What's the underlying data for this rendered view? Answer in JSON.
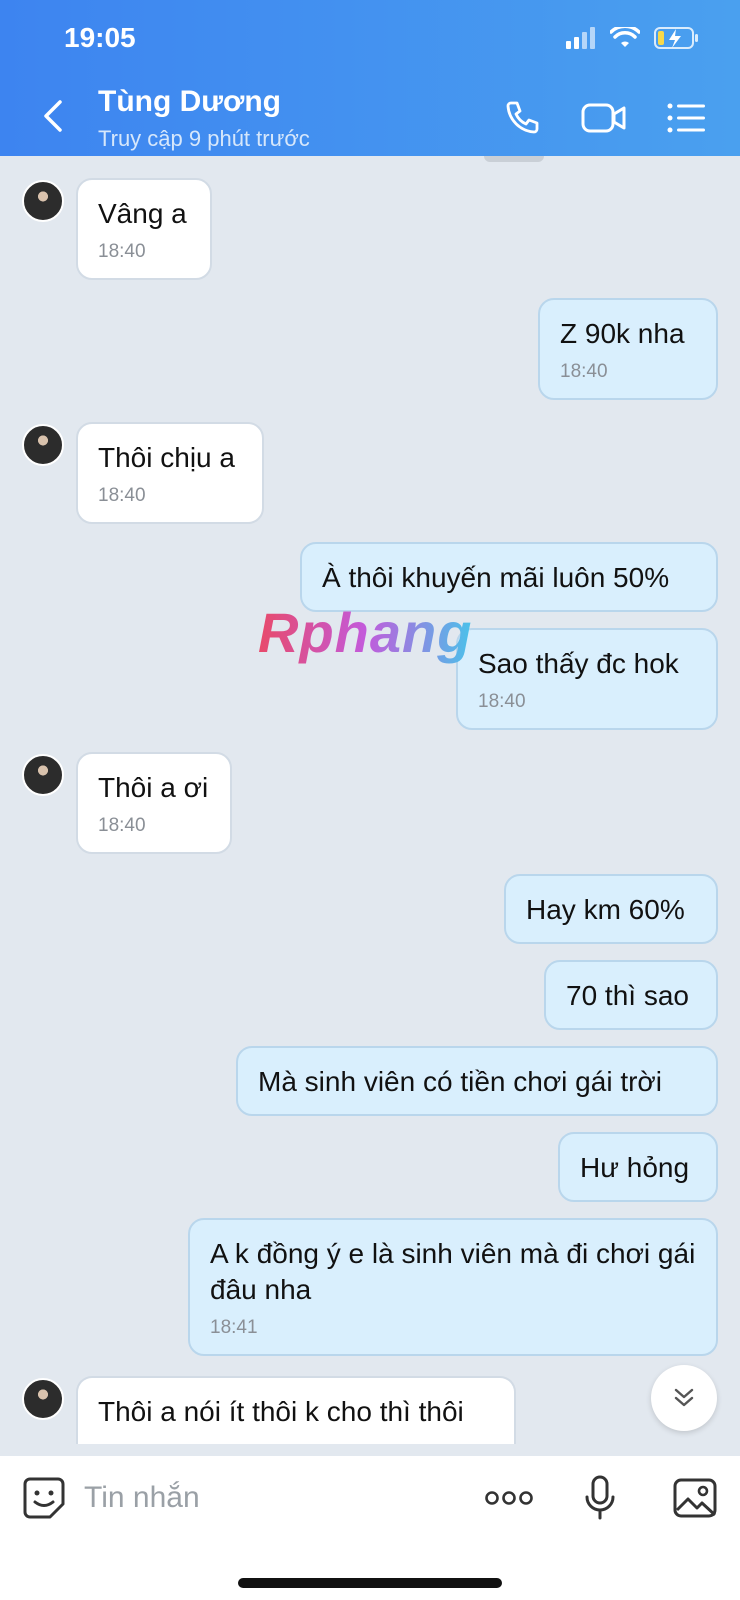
{
  "status_bar": {
    "time": "19:05"
  },
  "header": {
    "name": "Tùng Dương",
    "subtitle": "Truy cập 9 phút trước"
  },
  "messages": [
    {
      "side": "in",
      "text": "Vâng a",
      "time": "18:40"
    },
    {
      "side": "out",
      "text": "Z 90k nha",
      "time": "18:40"
    },
    {
      "side": "in",
      "text": "Thôi chịu a",
      "time": "18:40"
    },
    {
      "side": "out",
      "text": "À thôi khuyến mãi luôn 50%",
      "time": ""
    },
    {
      "side": "out",
      "text": "Sao thấy đc hok",
      "time": "18:40"
    },
    {
      "side": "in",
      "text": "Thôi a ơi",
      "time": "18:40"
    },
    {
      "side": "out",
      "text": "Hay km 60%",
      "time": ""
    },
    {
      "side": "out",
      "text": "70 thì sao",
      "time": ""
    },
    {
      "side": "out",
      "text": "Mà sinh viên có tiền chơi gái trời",
      "time": ""
    },
    {
      "side": "out",
      "text": "Hư hỏng",
      "time": ""
    },
    {
      "side": "out",
      "text": "A k đồng ý e là sinh viên mà đi chơi gái đâu nha",
      "time": "18:41"
    },
    {
      "side": "in",
      "text": "Thôi a nói ít thôi k cho thì thôi",
      "time": ""
    }
  ],
  "watermark": "Rphang",
  "input": {
    "placeholder": "Tin nhắn",
    "value": ""
  }
}
